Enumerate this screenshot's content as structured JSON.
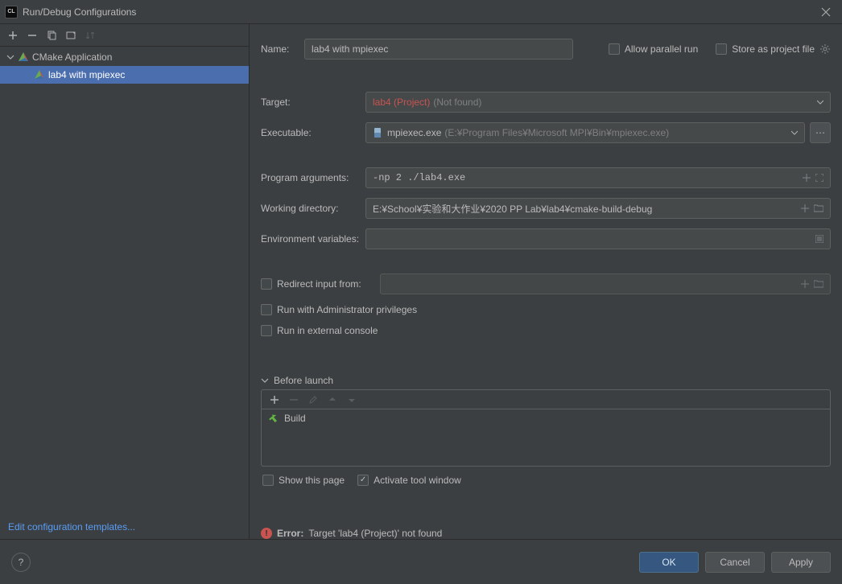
{
  "window": {
    "title": "Run/Debug Configurations"
  },
  "sidebar": {
    "root_label": "CMake Application",
    "item_label": "lab4 with mpiexec",
    "edit_templates": "Edit configuration templates..."
  },
  "form": {
    "name_label": "Name:",
    "name_value": "lab4 with mpiexec",
    "allow_parallel": "Allow parallel run",
    "store_as_project": "Store as project file",
    "target_label": "Target:",
    "target_value": "lab4 (Project)",
    "target_notfound": "(Not found)",
    "exe_label": "Executable:",
    "exe_name": "mpiexec.exe",
    "exe_path": "(E:¥Program Files¥Microsoft MPI¥Bin¥mpiexec.exe)",
    "args_label": "Program arguments:",
    "args_value": "-np 2 ./lab4.exe",
    "workdir_label": "Working directory:",
    "workdir_value": "E:¥School¥实验和大作业¥2020 PP Lab¥lab4¥cmake-build-debug",
    "env_label": "Environment variables:",
    "redirect_label": "Redirect input from:",
    "run_admin": "Run with Administrator privileges",
    "run_ext": "Run in external console"
  },
  "before_launch": {
    "header": "Before launch",
    "build": "Build",
    "show_this_page": "Show this page",
    "activate_tool_window": "Activate tool window"
  },
  "error": {
    "label": "Error:",
    "message": "Target 'lab4 (Project)' not found"
  },
  "buttons": {
    "ok": "OK",
    "cancel": "Cancel",
    "apply": "Apply"
  }
}
